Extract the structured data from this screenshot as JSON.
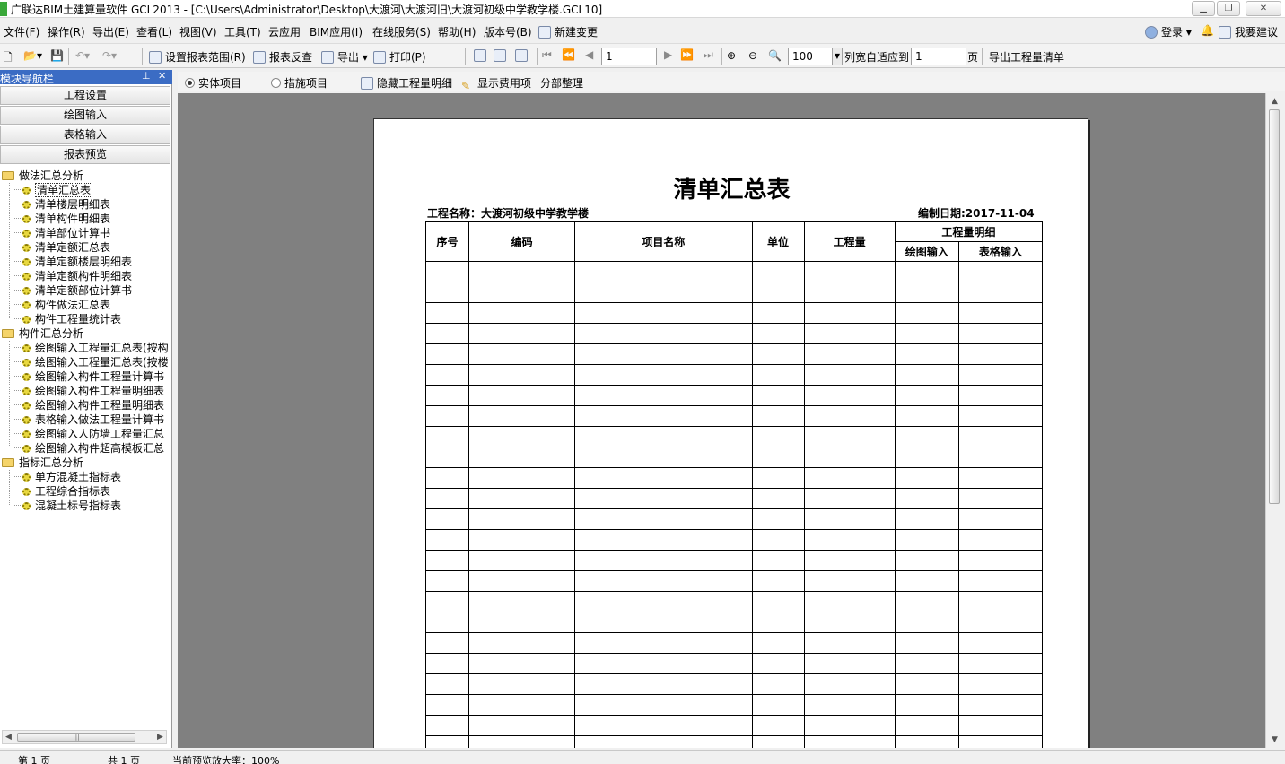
{
  "window": {
    "title": "广联达BIM土建算量软件 GCL2013 - [C:\\Users\\Administrator\\Desktop\\大渡河\\大渡河旧\\大渡河初级中学教学楼.GCL10]",
    "minimize": "▁",
    "restore": "❐",
    "close": "✕"
  },
  "menu": {
    "items": [
      "文件(F)",
      "操作(R)",
      "导出(E)",
      "查看(L)",
      "视图(V)",
      "工具(T)",
      "云应用",
      "BIM应用(I)",
      "在线服务(S)",
      "帮助(H)",
      "版本号(B)",
      "新建变更"
    ],
    "login": "登录",
    "suggest": "我要建议"
  },
  "toolbar": {
    "set_range": "设置报表范围(R)",
    "reverse_check": "报表反查",
    "export": "导出",
    "print": "打印(P)",
    "page_value": "1",
    "zoom_value": "100",
    "fit_label": "列宽自适应到",
    "fit_value": "1",
    "page_unit": "页",
    "export_list": "导出工程量清单"
  },
  "sidebar": {
    "title": "模块导航栏",
    "pin": "📌",
    "close": "✕",
    "nav_buttons": [
      "工程设置",
      "绘图输入",
      "表格输入",
      "报表预览"
    ],
    "groups": [
      {
        "label": "做法汇总分析",
        "items": [
          "清单汇总表",
          "清单楼层明细表",
          "清单构件明细表",
          "清单部位计算书",
          "清单定额汇总表",
          "清单定额楼层明细表",
          "清单定额构件明细表",
          "清单定额部位计算书",
          "构件做法汇总表",
          "构件工程量统计表"
        ]
      },
      {
        "label": "构件汇总分析",
        "items": [
          "绘图输入工程量汇总表(按构",
          "绘图输入工程量汇总表(按楼",
          "绘图输入构件工程量计算书",
          "绘图输入构件工程量明细表",
          "绘图输入构件工程量明细表",
          "表格输入做法工程量计算书",
          "绘图输入人防墙工程量汇总",
          "绘图输入构件超高模板汇总"
        ]
      },
      {
        "label": "指标汇总分析",
        "items": [
          "单方混凝土指标表",
          "工程综合指标表",
          "混凝土标号指标表"
        ]
      }
    ]
  },
  "subbar": {
    "radio_entity": "实体项目",
    "radio_measure": "措施项目",
    "hide_detail": "隐藏工程量明细",
    "show_cost": "显示费用项",
    "sort_sections": "分部整理"
  },
  "report": {
    "title": "清单汇总表",
    "project_label": "工程名称：大渡河初级中学教学楼",
    "date_label": "编制日期:2017-11-04",
    "headers": {
      "seq": "序号",
      "code": "编码",
      "name": "项目名称",
      "unit": "单位",
      "qty": "工程量",
      "detail": "工程量明细",
      "drawing": "绘图输入",
      "table": "表格输入"
    }
  },
  "status": {
    "current_page": "第 1 页",
    "total_pages": "共 1 页",
    "zoom": "当前预览放大率：100%"
  }
}
